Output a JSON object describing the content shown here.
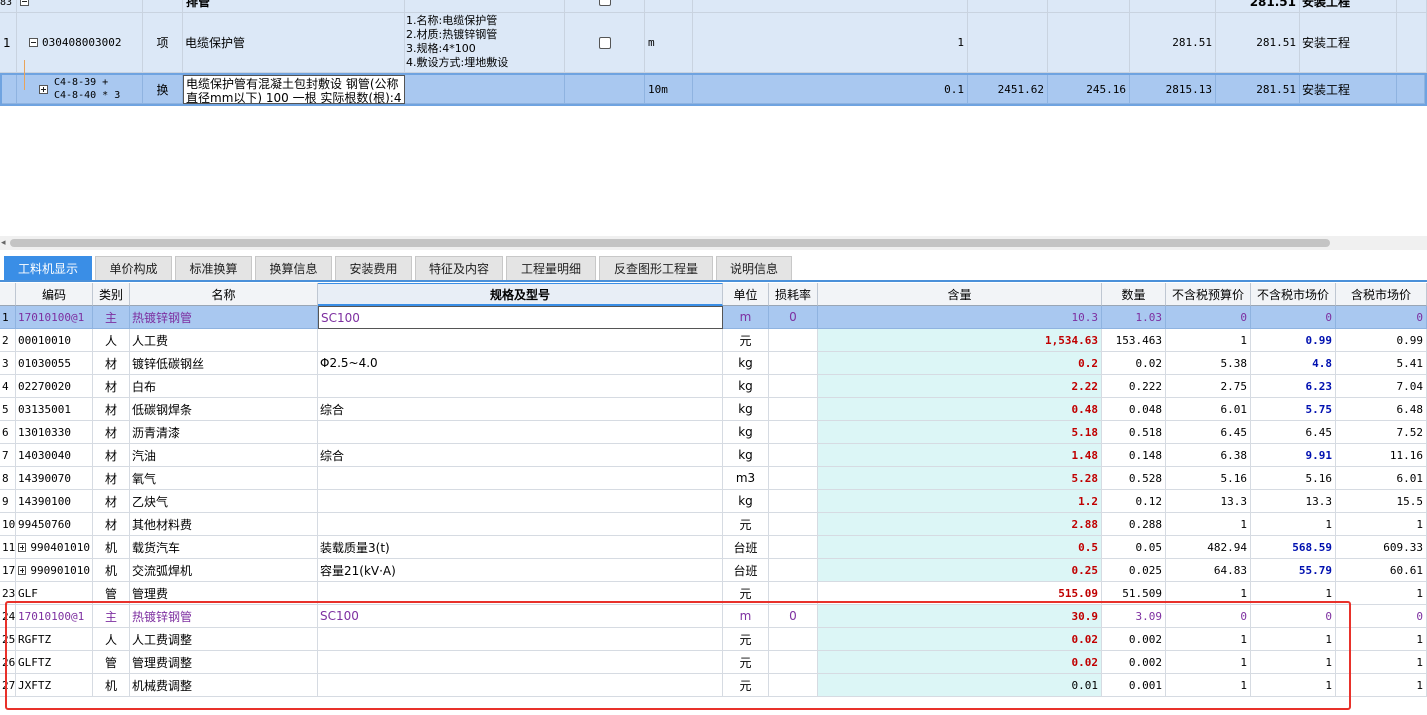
{
  "top_grid": {
    "row0": {
      "num": "83",
      "name": "排管",
      "price": "281.51",
      "spec": "安装工程"
    },
    "row1": {
      "num": "1",
      "code": "030408003002",
      "type": "项",
      "name": "电缆保护管",
      "features": [
        "1.名称:电缆保护管",
        "2.材质:热镀锌钢管",
        "3.规格:4*100",
        "4.敷设方式:埋地敷设"
      ],
      "unit": "m",
      "qty": "1",
      "total": "281.51",
      "price": "281.51",
      "spec": "安装工程"
    },
    "row2": {
      "code1": "C4-8-39 +",
      "code2": "C4-8-40 * 3",
      "type": "换",
      "name1": "电缆保护管有混凝土包封敷设 钢管(公称",
      "name2": "直径mm以下) 100 一根  实际根数(根):4",
      "unit": "10m",
      "qty": "0.1",
      "v1": "2451.62",
      "v2": "245.16",
      "total": "2815.13",
      "price": "281.51",
      "spec": "安装工程"
    }
  },
  "tabs": [
    "工料机显示",
    "单价构成",
    "标准换算",
    "换算信息",
    "安装费用",
    "特征及内容",
    "工程量明细",
    "反查图形工程量",
    "说明信息"
  ],
  "columns": [
    "编码",
    "类别",
    "名称",
    "规格及型号",
    "单位",
    "损耗率",
    "含量",
    "数量",
    "不含税预算价",
    "不含税市场价",
    "含税市场价"
  ],
  "rows": [
    {
      "n": "1",
      "code": "17010100@1",
      "cat": "主",
      "name": "热镀锌钢管",
      "spec": "SC100",
      "unit": "m",
      "loss": "0",
      "content": "10.3",
      "qty": "1.03",
      "budget": "0",
      "market": "0",
      "taxm": "0",
      "style": "main-selected"
    },
    {
      "n": "2",
      "code": "00010010",
      "cat": "人",
      "name": "人工费",
      "spec": "",
      "unit": "元",
      "loss": "",
      "content": "1,534.63",
      "qty": "153.463",
      "budget": "1",
      "market": "0.99",
      "taxm": "0.99",
      "market_blue": true
    },
    {
      "n": "3",
      "code": "01030055",
      "cat": "材",
      "name": "镀锌低碳钢丝",
      "spec": "Φ2.5~4.0",
      "unit": "kg",
      "loss": "",
      "content": "0.2",
      "qty": "0.02",
      "budget": "5.38",
      "market": "4.8",
      "taxm": "5.41",
      "market_blue": true
    },
    {
      "n": "4",
      "code": "02270020",
      "cat": "材",
      "name": "白布",
      "spec": "",
      "unit": "kg",
      "loss": "",
      "content": "2.22",
      "qty": "0.222",
      "budget": "2.75",
      "market": "6.23",
      "taxm": "7.04",
      "market_blue": true
    },
    {
      "n": "5",
      "code": "03135001",
      "cat": "材",
      "name": "低碳钢焊条",
      "spec": "综合",
      "unit": "kg",
      "loss": "",
      "content": "0.48",
      "qty": "0.048",
      "budget": "6.01",
      "market": "5.75",
      "taxm": "6.48",
      "market_blue": true
    },
    {
      "n": "6",
      "code": "13010330",
      "cat": "材",
      "name": "沥青清漆",
      "spec": "",
      "unit": "kg",
      "loss": "",
      "content": "5.18",
      "qty": "0.518",
      "budget": "6.45",
      "market": "6.45",
      "taxm": "7.52",
      "market_blue": false
    },
    {
      "n": "7",
      "code": "14030040",
      "cat": "材",
      "name": "汽油",
      "spec": "综合",
      "unit": "kg",
      "loss": "",
      "content": "1.48",
      "qty": "0.148",
      "budget": "6.38",
      "market": "9.91",
      "taxm": "11.16",
      "market_blue": true
    },
    {
      "n": "8",
      "code": "14390070",
      "cat": "材",
      "name": "氧气",
      "spec": "",
      "unit": "m3",
      "loss": "",
      "content": "5.28",
      "qty": "0.528",
      "budget": "5.16",
      "market": "5.16",
      "taxm": "6.01",
      "market_blue": false
    },
    {
      "n": "9",
      "code": "14390100",
      "cat": "材",
      "name": "乙炔气",
      "spec": "",
      "unit": "kg",
      "loss": "",
      "content": "1.2",
      "qty": "0.12",
      "budget": "13.3",
      "market": "13.3",
      "taxm": "15.5",
      "market_blue": false
    },
    {
      "n": "10",
      "code": "99450760",
      "cat": "材",
      "name": "其他材料费",
      "spec": "",
      "unit": "元",
      "loss": "",
      "content": "2.88",
      "qty": "0.288",
      "budget": "1",
      "market": "1",
      "taxm": "1",
      "market_blue": false
    },
    {
      "n": "11",
      "code": "990401010",
      "cat": "机",
      "name": "载货汽车",
      "spec": "装载质量3(t)",
      "unit": "台班",
      "loss": "",
      "content": "0.5",
      "qty": "0.05",
      "budget": "482.94",
      "market": "568.59",
      "taxm": "609.33",
      "market_blue": true,
      "expand": true
    },
    {
      "n": "17",
      "code": "990901010",
      "cat": "机",
      "name": "交流弧焊机",
      "spec": "容量21(kV·A)",
      "unit": "台班",
      "loss": "",
      "content": "0.25",
      "qty": "0.025",
      "budget": "64.83",
      "market": "55.79",
      "taxm": "60.61",
      "market_blue": true,
      "expand": true
    },
    {
      "n": "23",
      "code": "GLF",
      "cat": "管",
      "name": "管理费",
      "spec": "",
      "unit": "元",
      "loss": "",
      "content": "515.09",
      "qty": "51.509",
      "budget": "1",
      "market": "1",
      "taxm": "1",
      "market_blue": false,
      "content_wide": true
    },
    {
      "n": "24",
      "code": "17010100@1",
      "cat": "主",
      "name": "热镀锌钢管",
      "spec": "SC100",
      "unit": "m",
      "loss": "0",
      "content": "30.9",
      "qty": "3.09",
      "budget": "0",
      "market": "0",
      "taxm": "0",
      "style": "main"
    },
    {
      "n": "25",
      "code": "RGFTZ",
      "cat": "人",
      "name": "人工费调整",
      "spec": "",
      "unit": "元",
      "loss": "",
      "content": "0.02",
      "qty": "0.002",
      "budget": "1",
      "market": "1",
      "taxm": "1",
      "market_blue": false
    },
    {
      "n": "26",
      "code": "GLFTZ",
      "cat": "管",
      "name": "管理费调整",
      "spec": "",
      "unit": "元",
      "loss": "",
      "content": "0.02",
      "qty": "0.002",
      "budget": "1",
      "market": "1",
      "taxm": "1",
      "market_blue": false
    },
    {
      "n": "27",
      "code": "JXFTZ",
      "cat": "机",
      "name": "机械费调整",
      "spec": "",
      "unit": "元",
      "loss": "",
      "content": "0.01",
      "qty": "0.001",
      "budget": "1",
      "market": "1",
      "taxm": "1",
      "market_blue": false,
      "plain_content": true
    }
  ],
  "colors": {
    "accent": "#3a8ee6",
    "highlight_red": "#e8312a",
    "content_red": "#c00000",
    "market_blue": "#0010b0",
    "main_purple": "#7d2fa0",
    "selected_row": "#a9c8f0"
  }
}
